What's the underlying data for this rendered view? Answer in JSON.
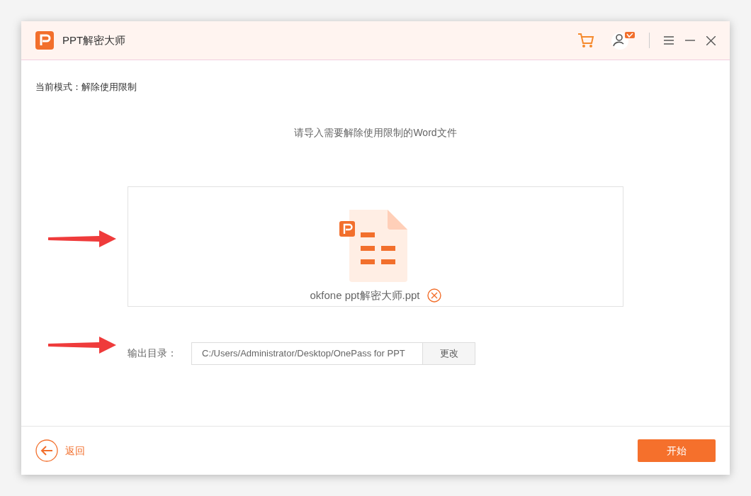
{
  "window": {
    "title": "PPT解密大师"
  },
  "mode_label": "当前模式：解除使用限制",
  "instruction": "请导入需要解除使用限制的Word文件",
  "file": {
    "name": "okfone ppt解密大师.ppt"
  },
  "output": {
    "label": "输出目录：",
    "path": "C:/Users/Administrator/Desktop/OnePass for PPT",
    "change_button": "更改"
  },
  "back_button": "返回",
  "start_button": "开始"
}
